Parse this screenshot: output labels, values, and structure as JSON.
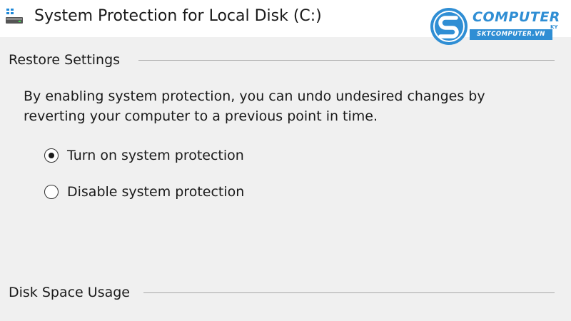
{
  "window": {
    "title": "System Protection for Local Disk (C:)",
    "icon": "drive-icon"
  },
  "watermark": {
    "brand": "COMPUTER",
    "superscript": "KY",
    "subtitle": "SKTCOMPUTER.VN",
    "color": "#2f8ed4"
  },
  "restore_settings": {
    "heading": "Restore Settings",
    "description": "By enabling system protection, you can undo undesired changes by reverting your computer to a previous point in time.",
    "options": [
      {
        "label": "Turn on system protection",
        "selected": true
      },
      {
        "label": "Disable system protection",
        "selected": false
      }
    ]
  },
  "disk_space_usage": {
    "heading": "Disk Space Usage"
  }
}
